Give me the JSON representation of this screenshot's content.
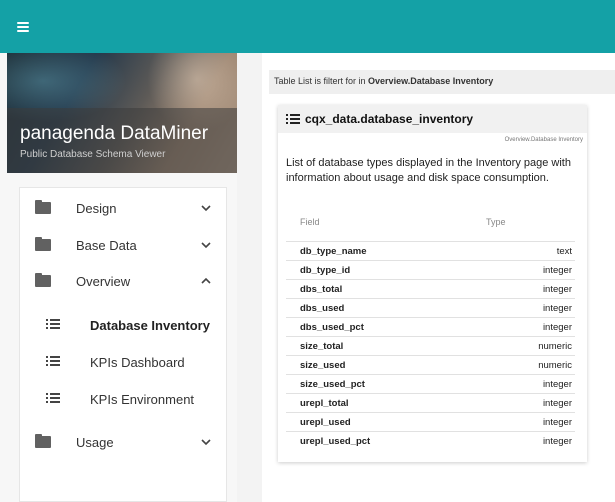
{
  "app": {
    "title": "panagenda DataMiner",
    "subtitle": "Public Database Schema Viewer"
  },
  "colors": {
    "topbar": "#14a1a6"
  },
  "nav": {
    "items": [
      {
        "label": "Design",
        "icon": "folder-icon",
        "expanded": false
      },
      {
        "label": "Base Data",
        "icon": "folder-icon",
        "expanded": false
      },
      {
        "label": "Overview",
        "icon": "folder-icon",
        "expanded": true
      },
      {
        "label": "Usage",
        "icon": "folder-icon",
        "expanded": false
      }
    ],
    "overview_children": [
      {
        "label": "Database Inventory",
        "icon": "list-icon",
        "active": true
      },
      {
        "label": "KPIs Dashboard",
        "icon": "list-icon",
        "active": false
      },
      {
        "label": "KPIs Environment",
        "icon": "list-icon",
        "active": false
      }
    ]
  },
  "filter": {
    "prefix": "Table List is filtert for in ",
    "value": "Overview.Database Inventory"
  },
  "table_card": {
    "title": "cqx_data.database_inventory",
    "tag": "Overview.Database Inventory",
    "description": "List of database types displayed in the Inventory page with information about usage and disk space consumption.",
    "columns": {
      "field": "Field",
      "type": "Type"
    },
    "rows": [
      {
        "field": "db_type_name",
        "type": "text"
      },
      {
        "field": "db_type_id",
        "type": "integer"
      },
      {
        "field": "dbs_total",
        "type": "integer"
      },
      {
        "field": "dbs_used",
        "type": "integer"
      },
      {
        "field": "dbs_used_pct",
        "type": "integer"
      },
      {
        "field": "size_total",
        "type": "numeric"
      },
      {
        "field": "size_used",
        "type": "numeric"
      },
      {
        "field": "size_used_pct",
        "type": "integer"
      },
      {
        "field": "urepl_total",
        "type": "integer"
      },
      {
        "field": "urepl_used",
        "type": "integer"
      },
      {
        "field": "urepl_used_pct",
        "type": "integer"
      }
    ]
  }
}
